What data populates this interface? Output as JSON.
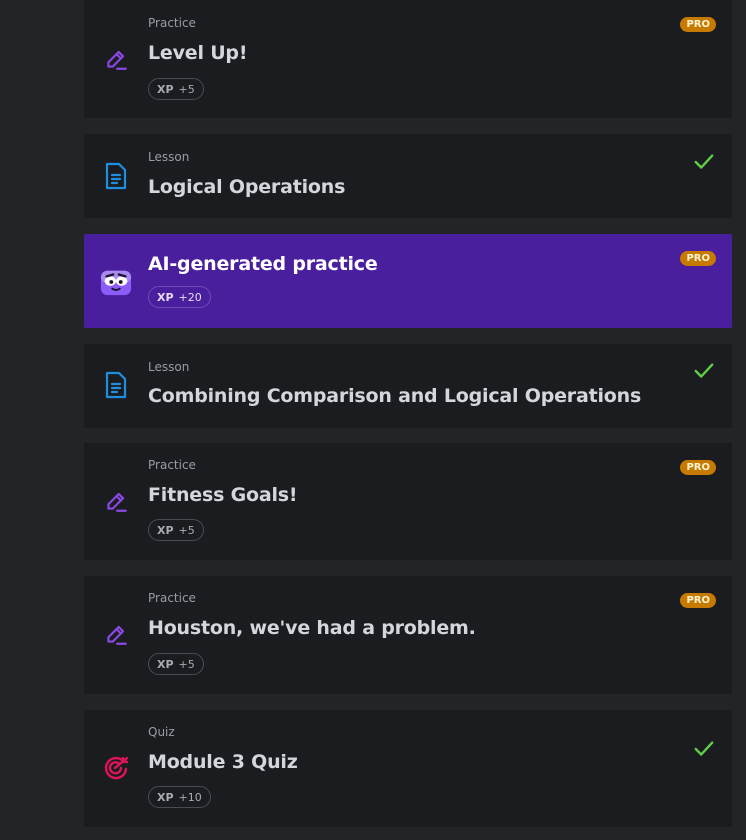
{
  "colors": {
    "practice_icon": "#8a49e6",
    "lesson_icon": "#1e8fe0",
    "quiz_icon": "#e0135a",
    "check": "#5fd046",
    "pro_badge": "#c77a00",
    "highlight_bg": "#4a1f9e"
  },
  "items": [
    {
      "type": "Practice",
      "title": "Level Up!",
      "xp_label": "XP",
      "xp_value": "+5",
      "badge": "PRO",
      "icon": "pencil-icon"
    },
    {
      "type": "Lesson",
      "title": "Logical Operations",
      "status": "completed",
      "icon": "document-icon"
    },
    {
      "type": "",
      "title": "AI-generated practice",
      "xp_label": "XP",
      "xp_value": "+20",
      "badge": "PRO",
      "icon": "ai-robot-icon",
      "highlighted": true
    },
    {
      "type": "Lesson",
      "title": "Combining Comparison and Logical Operations",
      "status": "completed",
      "icon": "document-icon"
    },
    {
      "type": "Practice",
      "title": "Fitness Goals!",
      "xp_label": "XP",
      "xp_value": "+5",
      "badge": "PRO",
      "icon": "pencil-icon"
    },
    {
      "type": "Practice",
      "title": "Houston, we've had a problem.",
      "xp_label": "XP",
      "xp_value": "+5",
      "badge": "PRO",
      "icon": "pencil-icon"
    },
    {
      "type": "Quiz",
      "title": "Module 3 Quiz",
      "xp_label": "XP",
      "xp_value": "+10",
      "status": "completed",
      "icon": "target-icon"
    }
  ]
}
